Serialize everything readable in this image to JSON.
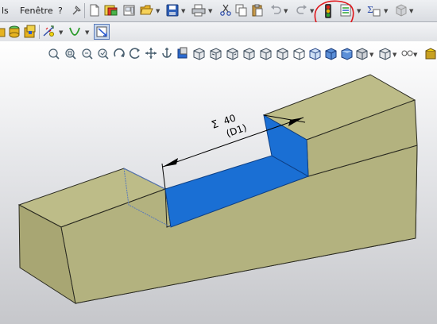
{
  "menu": {
    "item_outils_fragment": "ls",
    "item_fenetre": "Fenêtre",
    "item_help": "?"
  },
  "viewport": {
    "dimension": {
      "sigma_symbol": "Σ",
      "value": "40",
      "name": "(D1)"
    }
  },
  "colors": {
    "part_face": "#b3b27f",
    "part_top": "#bdbc88",
    "part_side": "#a8a673",
    "pocket": "#1a6fd4",
    "annotation_circle": "#e0161a"
  },
  "icons": {
    "menubar": [
      "pin-icon",
      "new-document-icon",
      "new-from-template-icon",
      "drawing-icon",
      "open-folder-icon",
      "save-icon",
      "print-icon",
      "cut-icon",
      "copy-icon",
      "paste-icon",
      "undo-icon",
      "redo-icon",
      "rebuild-traffic-light-icon",
      "options-icon",
      "equation-icon",
      "file-properties-icon",
      "photoview-icon"
    ],
    "toolbar2": [
      "extrude-boss-icon",
      "revolve-icon",
      "fillet-icon",
      "smart-dimension-icon",
      "curve-icon",
      "select-icon"
    ],
    "view_toolbar": [
      "zoom-to-fit-icon",
      "zoom-to-area-icon",
      "zoom-in-out-icon",
      "zoom-to-selection-icon",
      "rotate-view-icon",
      "roll-view-icon",
      "pan-icon",
      "previous-view-icon",
      "section-view-icon",
      "view-orientation-icon",
      "standard-views-icon",
      "isometric-icon",
      "trimetric-icon",
      "dimetric-icon",
      "top-view-icon",
      "wireframe-icon",
      "hidden-lines-visible-icon",
      "hidden-lines-removed-icon",
      "shaded-with-edges-icon",
      "shaded-icon",
      "display-style-icon",
      "hide-show-items-icon",
      "appearance-icon",
      "scene-icon"
    ]
  }
}
